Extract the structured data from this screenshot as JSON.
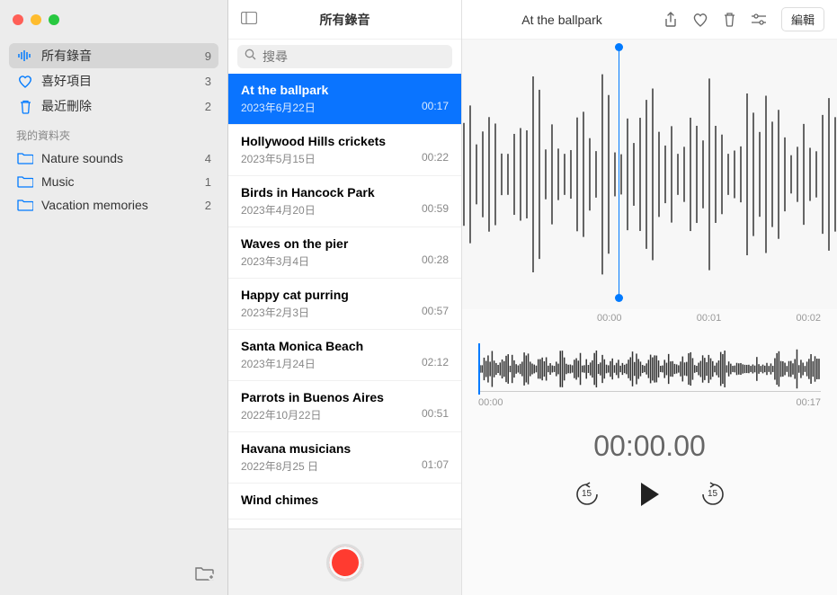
{
  "header": {
    "title": "At the ballpark",
    "edit_label": "編輯"
  },
  "sidebar": {
    "smart_folders": [
      {
        "icon": "waveform",
        "label": "所有錄音",
        "count": "9",
        "selected": true
      },
      {
        "icon": "heart",
        "label": "喜好項目",
        "count": "3",
        "selected": false
      },
      {
        "icon": "trash",
        "label": "最近刪除",
        "count": "2",
        "selected": false
      }
    ],
    "section_label": "我的資料夾",
    "folders": [
      {
        "label": "Nature sounds",
        "count": "4"
      },
      {
        "label": "Music",
        "count": "1"
      },
      {
        "label": "Vacation memories",
        "count": "2"
      }
    ]
  },
  "middle": {
    "title": "所有錄音",
    "search_placeholder": "搜尋",
    "recordings": [
      {
        "title": "At the ballpark",
        "date": "2023年6月22日",
        "duration": "00:17",
        "selected": true
      },
      {
        "title": "Hollywood Hills crickets",
        "date": "2023年5月15日",
        "duration": "00:22"
      },
      {
        "title": "Birds in Hancock Park",
        "date": "2023年4月20日",
        "duration": "00:59"
      },
      {
        "title": "Waves on the pier",
        "date": "2023年3月4日",
        "duration": "00:28"
      },
      {
        "title": "Happy cat purring",
        "date": "2023年2月3日",
        "duration": "00:57"
      },
      {
        "title": "Santa Monica Beach",
        "date": "2023年1月24日",
        "duration": "02:12"
      },
      {
        "title": "Parrots in Buenos Aires",
        "date": "2022年10月22日",
        "duration": "00:51"
      },
      {
        "title": "Havana musicians",
        "date": "2022年8月25 日",
        "duration": "01:07"
      },
      {
        "title": "Wind chimes",
        "date": "",
        "duration": ""
      }
    ]
  },
  "detail": {
    "big_ticks": [
      "00:00",
      "00:01",
      "00:02"
    ],
    "small_ticks": {
      "start": "00:00",
      "end": "00:17"
    },
    "time": "00:00.00",
    "skip_seconds": "15"
  }
}
